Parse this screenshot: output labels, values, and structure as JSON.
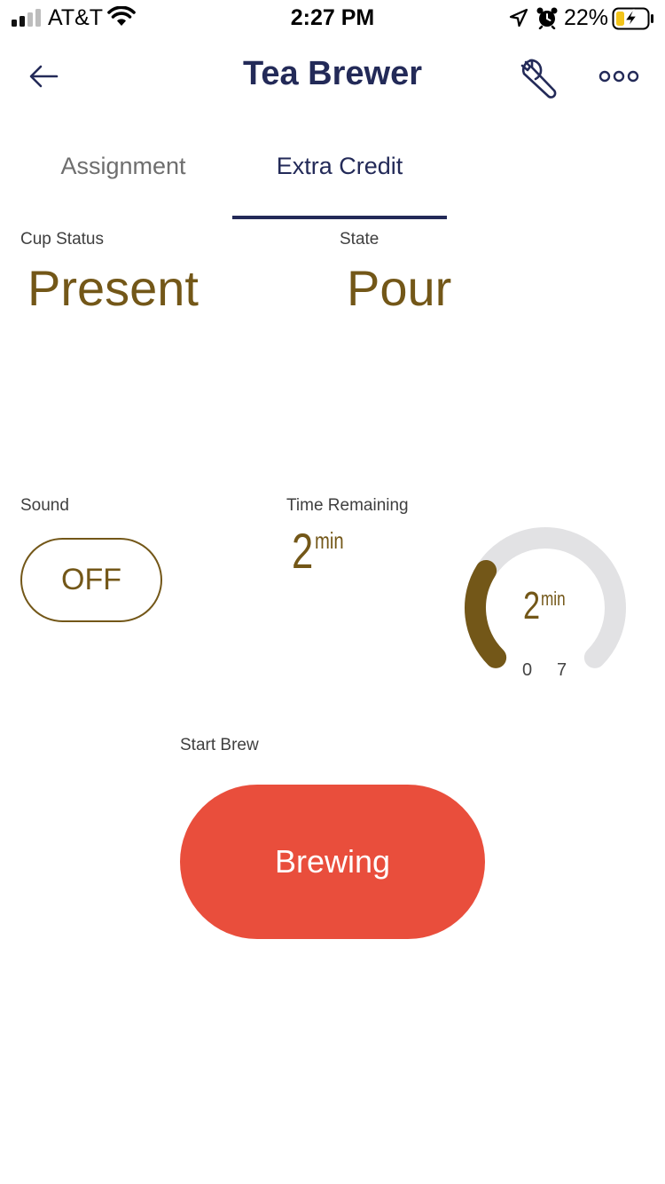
{
  "status_bar": {
    "carrier": "AT&T",
    "time": "2:27 PM",
    "battery_percent": "22%",
    "signal_bars_active": 2,
    "signal_bars_total": 4,
    "icons": [
      "signal-icon",
      "wifi-icon",
      "location-icon",
      "alarm-icon",
      "battery-charging-icon"
    ]
  },
  "nav": {
    "title": "Tea Brewer",
    "back_icon": "back-arrow-icon",
    "settings_icon": "wrench-icon",
    "more_icon": "more-dots-icon"
  },
  "tabs": [
    {
      "label": "Assignment",
      "active": false
    },
    {
      "label": "Extra Credit",
      "active": true
    }
  ],
  "cup_status": {
    "label": "Cup Status",
    "value": "Present"
  },
  "state": {
    "label": "State",
    "value": "Pour"
  },
  "sound": {
    "label": "Sound",
    "button_label": "OFF"
  },
  "time_remaining": {
    "label": "Time Remaining",
    "value": "2",
    "unit": "min"
  },
  "gauge": {
    "value": "2",
    "unit": "min",
    "min_label": "0",
    "max_label": "7",
    "min": 0,
    "max": 7,
    "current": 2,
    "fill_color": "#735718",
    "track_color": "#e2e2e4"
  },
  "brew": {
    "label": "Start Brew",
    "button_label": "Brewing",
    "button_color": "#e94e3c"
  },
  "colors": {
    "accent": "#232a58",
    "value_text": "#735718"
  }
}
